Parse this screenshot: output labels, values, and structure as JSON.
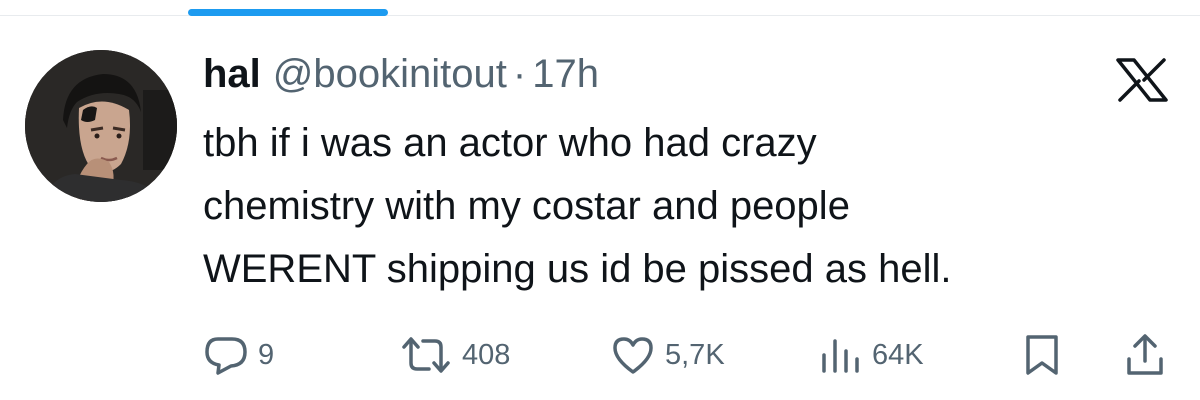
{
  "tweet": {
    "author": {
      "display_name": "hal",
      "handle": "@bookinitout",
      "separator": "·",
      "time": "17h"
    },
    "text_lines": [
      "tbh if i was an actor who had crazy",
      "chemistry with my costar and people",
      "WERENT shipping us id be pissed as hell."
    ],
    "platform_icon": "x-logo-icon"
  },
  "actions": {
    "reply": {
      "icon": "reply-icon",
      "count": "9"
    },
    "retweet": {
      "icon": "retweet-icon",
      "count": "408"
    },
    "like": {
      "icon": "heart-icon",
      "count": "5,7K"
    },
    "views": {
      "icon": "views-chart-icon",
      "count": "64K"
    },
    "bookmark": {
      "icon": "bookmark-icon"
    },
    "share": {
      "icon": "share-icon"
    }
  },
  "colors": {
    "accent": "#1d9bf0",
    "text_primary": "#0f1419",
    "text_secondary": "#536471",
    "divider": "#e8ebee"
  }
}
